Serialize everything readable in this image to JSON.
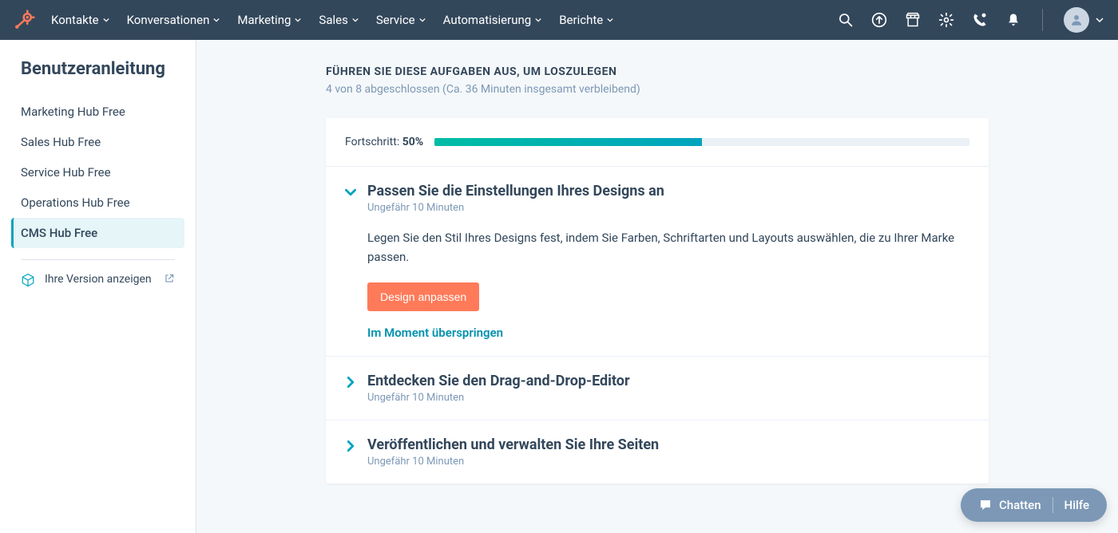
{
  "nav": {
    "items": [
      "Kontakte",
      "Konversationen",
      "Marketing",
      "Sales",
      "Service",
      "Automatisierung",
      "Berichte"
    ]
  },
  "sidebar": {
    "title": "Benutzeranleitung",
    "items": [
      {
        "label": "Marketing Hub Free",
        "active": false
      },
      {
        "label": "Sales Hub Free",
        "active": false
      },
      {
        "label": "Service Hub Free",
        "active": false
      },
      {
        "label": "Operations Hub Free",
        "active": false
      },
      {
        "label": "CMS Hub Free",
        "active": true
      }
    ],
    "versionLink": "Ihre Version anzeigen"
  },
  "header": {
    "title": "FÜHREN SIE DIESE AUFGABEN AUS, UM LOSZULEGEN",
    "subtitle": "4 von 8 abgeschlossen (Ca. 36 Minuten insgesamt verbleibend)"
  },
  "progress": {
    "label": "Fortschritt:",
    "value": "50%",
    "percent": 50
  },
  "tasks": [
    {
      "title": "Passen Sie die Einstellungen Ihres Designs an",
      "duration": "Ungefähr 10 Minuten",
      "expanded": true,
      "description": "Legen Sie den Stil Ihres Designs fest, indem Sie Farben, Schriftarten und Layouts auswählen, die zu Ihrer Marke passen.",
      "cta": "Design anpassen",
      "skip": "Im Moment überspringen"
    },
    {
      "title": "Entdecken Sie den Drag-and-Drop-Editor",
      "duration": "Ungefähr 10 Minuten",
      "expanded": false
    },
    {
      "title": "Veröffentlichen und verwalten Sie Ihre Seiten",
      "duration": "Ungefähr 10 Minuten",
      "expanded": false
    }
  ],
  "help": {
    "chat": "Chatten",
    "help": "Hilfe"
  }
}
